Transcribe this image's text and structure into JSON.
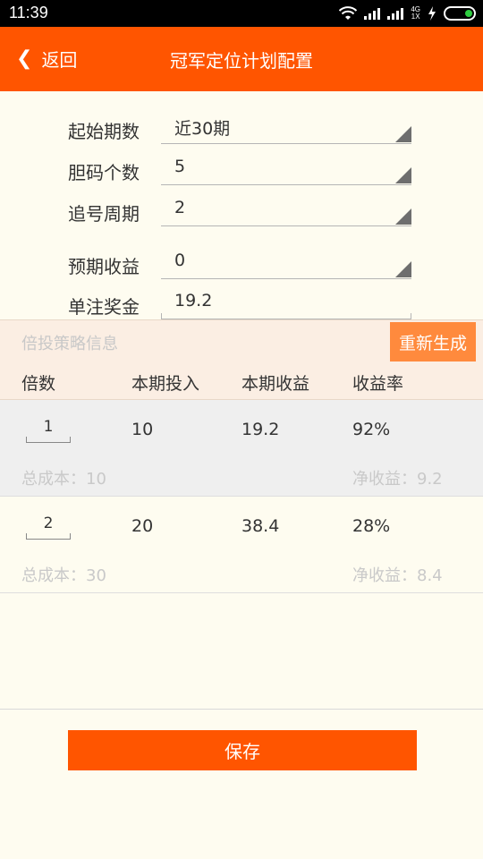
{
  "status": {
    "time": "11:39",
    "network_top": "4G",
    "network_bottom": "1X"
  },
  "header": {
    "back_label": "返回",
    "title": "冠军定位计划配置"
  },
  "form": [
    {
      "label": "起始期数",
      "value": "近30期",
      "type": "select"
    },
    {
      "label": "胆码个数",
      "value": "5",
      "type": "select"
    },
    {
      "label": "追号周期",
      "value": "2",
      "type": "select"
    },
    {
      "label": "预期收益",
      "value": "0",
      "type": "select"
    },
    {
      "label": "单注奖金",
      "value": "19.2",
      "type": "text"
    }
  ],
  "strategy": {
    "title": "倍投策略信息",
    "regen_label": "重新生成",
    "columns": [
      "倍数",
      "本期投入",
      "本期收益",
      "收益率"
    ]
  },
  "rows": [
    {
      "multiplier": "1",
      "invest": "10",
      "income": "19.2",
      "rate": "92%",
      "total_cost": "总成本：10",
      "net_income": "净收益：9.2"
    },
    {
      "multiplier": "2",
      "invest": "20",
      "income": "38.4",
      "rate": "28%",
      "total_cost": "总成本：30",
      "net_income": "净收益：8.4"
    }
  ],
  "footer": {
    "save_label": "保存"
  },
  "colors": {
    "brand": "#ff5500",
    "regen": "#ff8a3d",
    "background": "#fefcf0"
  }
}
